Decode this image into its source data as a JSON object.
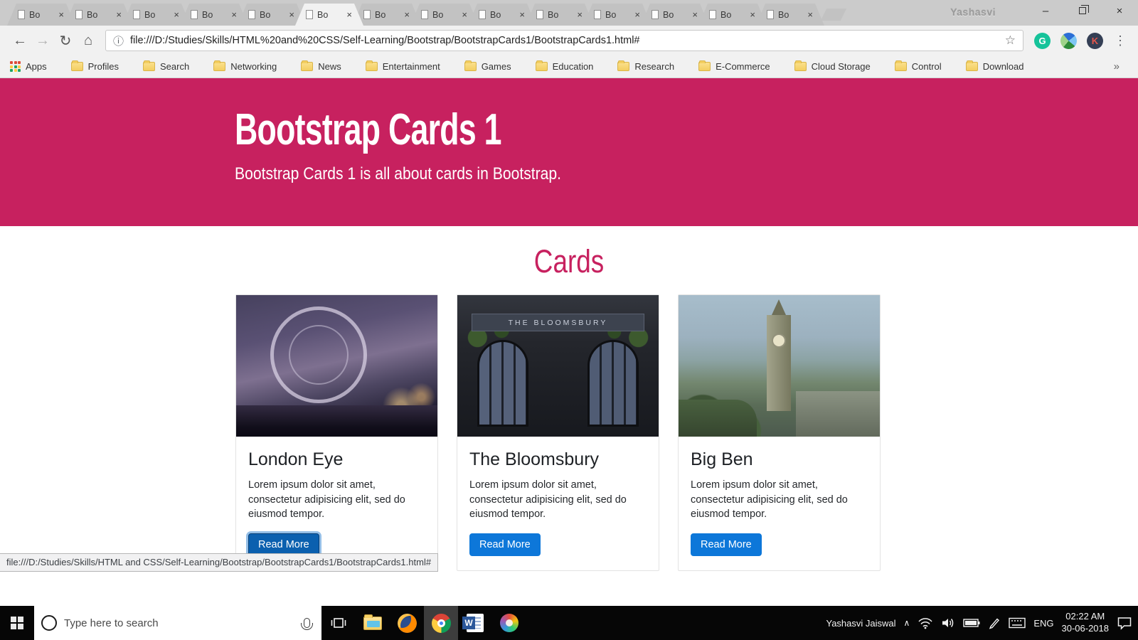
{
  "browser": {
    "tabs": [
      {
        "label": "Bo"
      },
      {
        "label": "Bo"
      },
      {
        "label": "Bo"
      },
      {
        "label": "Bo"
      },
      {
        "label": "Bo"
      },
      {
        "label": "Bo"
      },
      {
        "label": "Bo"
      },
      {
        "label": "Bo"
      },
      {
        "label": "Bo"
      },
      {
        "label": "Bo"
      },
      {
        "label": "Bo"
      },
      {
        "label": "Bo"
      },
      {
        "label": "Bo"
      },
      {
        "label": "Bo"
      }
    ],
    "active_tab_index": 5,
    "profile_name": "Yashasvi",
    "icons": {
      "close": "×",
      "minimize": "–",
      "back": "←",
      "forward": "→",
      "reload": "↻",
      "home": "⌂",
      "info": "ⓘ",
      "star": "☆",
      "menu": "⋮",
      "chevron_up": "∧"
    },
    "url": "file:///D:/Studies/Skills/HTML%20and%20CSS/Self-Learning/Bootstrap/BootstrapCards1/BootstrapCards1.html#",
    "extensions": [
      {
        "name": "grammarly",
        "label": "G"
      },
      {
        "name": "idm",
        "label": ""
      },
      {
        "name": "k-extension",
        "label": "K"
      }
    ],
    "bookmarks": {
      "apps_label": "Apps",
      "folders": [
        "Profiles",
        "Search",
        "Networking",
        "News",
        "Entertainment",
        "Games",
        "Education",
        "Research",
        "E-Commerce",
        "Cloud Storage",
        "Control",
        "Download"
      ],
      "overflow": "»"
    }
  },
  "page": {
    "jumbotron": {
      "title": "Bootstrap Cards 1",
      "subtitle": "Bootstrap Cards 1 is all about cards in Bootstrap.",
      "bg_color": "#C7215F"
    },
    "section_title": "Cards",
    "cards": [
      {
        "title": "London Eye",
        "text": "Lorem ipsum dolor sit amet, consectetur adipisicing elit, sed do eiusmod tempor.",
        "button": "Read More",
        "image": "london-eye",
        "image_label": "",
        "focused": true
      },
      {
        "title": "The Bloomsbury",
        "text": "Lorem ipsum dolor sit amet, consectetur adipisicing elit, sed do eiusmod tempor.",
        "button": "Read More",
        "image": "bloomsbury",
        "image_label": "THE BLOOMSBURY",
        "focused": false
      },
      {
        "title": "Big Ben",
        "text": "Lorem ipsum dolor sit amet, consectetur adipisicing elit, sed do eiusmod tempor.",
        "button": "Read More",
        "image": "bigben",
        "image_label": "",
        "focused": false
      }
    ],
    "status_bar_text": "file:///D:/Studies/Skills/HTML and CSS/Self-Learning/Bootstrap/BootstrapCards1/BootstrapCards1.html#",
    "colors": {
      "accent_pink": "#C7215F",
      "button_blue": "#0D77D9",
      "button_blue_focused": "#0B60AF"
    }
  },
  "taskbar": {
    "search_placeholder": "Type here to search",
    "user_name": "Yashasvi Jaiswal",
    "language": "ENG",
    "time": "02:22 AM",
    "date": "30-06-2018"
  }
}
